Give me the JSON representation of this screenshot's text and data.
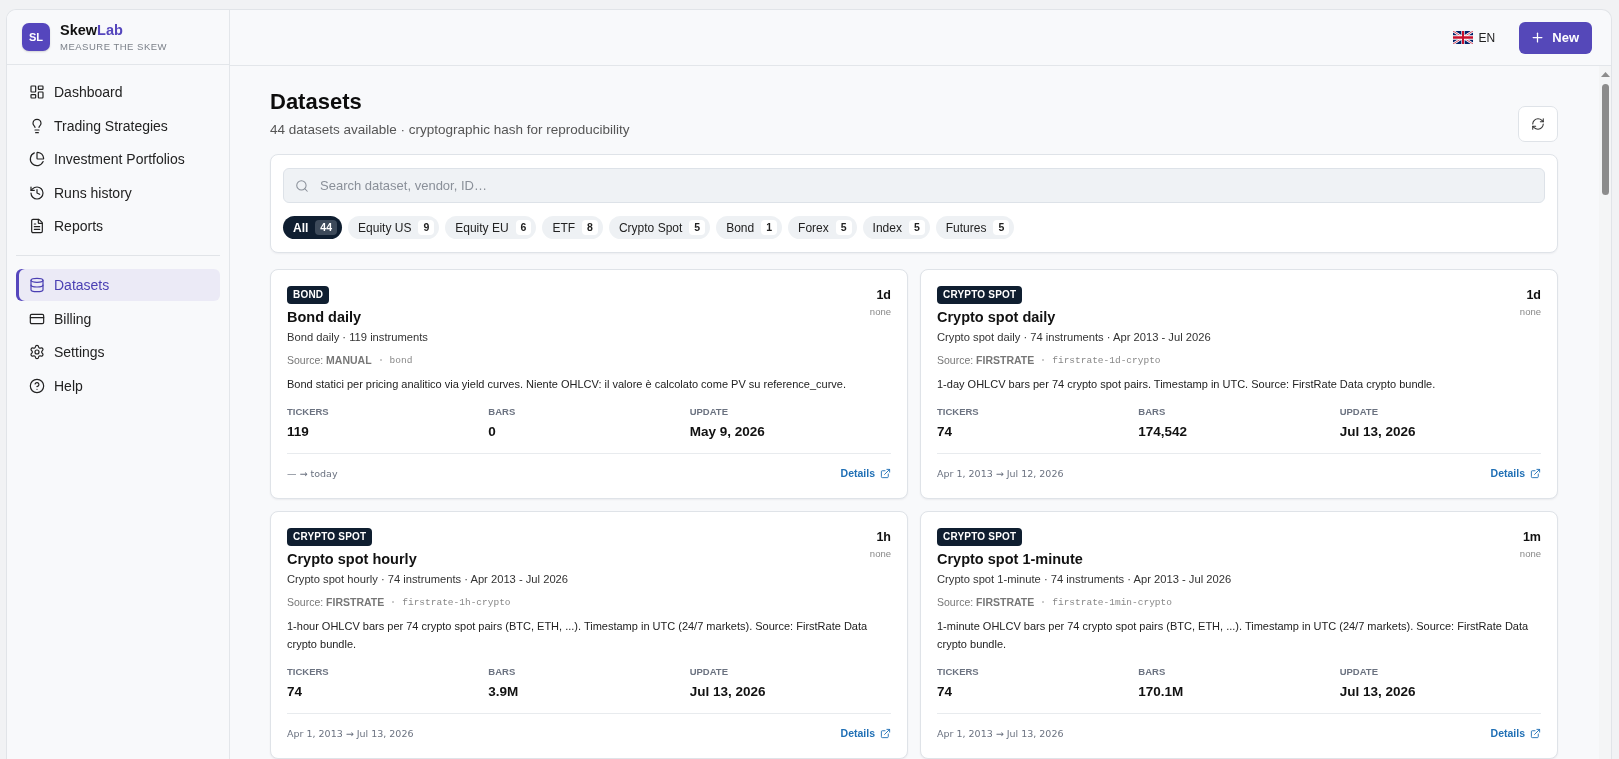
{
  "brand": {
    "logo": "SL",
    "name": "Skew",
    "name_accent": "Lab",
    "tagline": "MEASURE THE SKEW"
  },
  "sidebar": {
    "primary": [
      {
        "label": "Dashboard",
        "selected": false
      },
      {
        "label": "Trading Strategies",
        "selected": false
      },
      {
        "label": "Investment Portfolios",
        "selected": false
      },
      {
        "label": "Runs history",
        "selected": false
      },
      {
        "label": "Reports",
        "selected": false
      }
    ],
    "secondary": [
      {
        "label": "Datasets",
        "selected": true
      },
      {
        "label": "Billing",
        "selected": false
      },
      {
        "label": "Settings",
        "selected": false
      },
      {
        "label": "Help",
        "selected": false
      }
    ]
  },
  "header": {
    "language": "EN",
    "new_button": "New"
  },
  "page": {
    "title": "Datasets",
    "subtitle": "44 datasets available · cryptographic hash for reproducibility"
  },
  "search": {
    "placeholder": "Search dataset, vendor, ID…"
  },
  "filters": [
    {
      "label": "All",
      "count": "44",
      "selected": true
    },
    {
      "label": "Equity US",
      "count": "9",
      "selected": false
    },
    {
      "label": "Equity EU",
      "count": "6",
      "selected": false
    },
    {
      "label": "ETF",
      "count": "8",
      "selected": false
    },
    {
      "label": "Crypto Spot",
      "count": "5",
      "selected": false
    },
    {
      "label": "Bond",
      "count": "1",
      "selected": false
    },
    {
      "label": "Forex",
      "count": "5",
      "selected": false
    },
    {
      "label": "Index",
      "count": "5",
      "selected": false
    },
    {
      "label": "Futures",
      "count": "5",
      "selected": false
    }
  ],
  "datasets": [
    {
      "category": "BOND",
      "title": "Bond daily",
      "summary": "Bond daily · 119 instruments",
      "source": "Source: **MANUAL**",
      "dataset_id": "bond",
      "description": "Bond statici per pricing analitico via yield curves. Niente OHLCV: il valore è calcolato come PV su reference_curve.",
      "interval": "1d",
      "interval_note": "none",
      "stats": [
        {
          "label": "TICKERS",
          "value": "119"
        },
        {
          "label": "BARS",
          "value": "0"
        },
        {
          "label": "UPDATE",
          "value": "May 9, 2026"
        }
      ],
      "range": "— → today",
      "link": "Details"
    },
    {
      "category": "CRYPTO SPOT",
      "title": "Crypto spot daily",
      "summary": "Crypto spot daily · 74 instruments · Apr 2013 - Jul 2026",
      "source": "Source: **FIRSTRATE**",
      "dataset_id": "firstrate-1d-crypto",
      "description": "1-day OHLCV bars per 74 crypto spot pairs. Timestamp in UTC. Source: FirstRate Data crypto bundle.",
      "interval": "1d",
      "interval_note": "none",
      "stats": [
        {
          "label": "TICKERS",
          "value": "74"
        },
        {
          "label": "BARS",
          "value": "174,542"
        },
        {
          "label": "UPDATE",
          "value": "Jul 13, 2026"
        }
      ],
      "range": "Apr 1, 2013 → Jul 12, 2026",
      "link": "Details"
    },
    {
      "category": "CRYPTO SPOT",
      "title": "Crypto spot hourly",
      "summary": "Crypto spot hourly · 74 instruments · Apr 2013 - Jul 2026",
      "source": "Source: **FIRSTRATE**",
      "dataset_id": "firstrate-1h-crypto",
      "description": "1-hour OHLCV bars per 74 crypto spot pairs (BTC, ETH, ...). Timestamp in UTC (24/7 markets). Source: FirstRate Data crypto bundle.",
      "interval": "1h",
      "interval_note": "none",
      "stats": [
        {
          "label": "TICKERS",
          "value": "74"
        },
        {
          "label": "BARS",
          "value": "3.9M"
        },
        {
          "label": "UPDATE",
          "value": "Jul 13, 2026"
        }
      ],
      "range": "Apr 1, 2013 → Jul 13, 2026",
      "link": "Details"
    },
    {
      "category": "CRYPTO SPOT",
      "title": "Crypto spot 1-minute",
      "summary": "Crypto spot 1-minute · 74 instruments · Apr 2013 - Jul 2026",
      "source": "Source: **FIRSTRATE**",
      "dataset_id": "firstrate-1min-crypto",
      "description": "1-minute OHLCV bars per 74 crypto spot pairs (BTC, ETH, ...). Timestamp in UTC (24/7 markets). Source: FirstRate Data crypto bundle.",
      "interval": "1m",
      "interval_note": "none",
      "stats": [
        {
          "label": "TICKERS",
          "value": "74"
        },
        {
          "label": "BARS",
          "value": "170.1M"
        },
        {
          "label": "UPDATE",
          "value": "Jul 13, 2026"
        }
      ],
      "range": "Apr 1, 2013 → Jul 13, 2026",
      "link": "Details"
    }
  ]
}
